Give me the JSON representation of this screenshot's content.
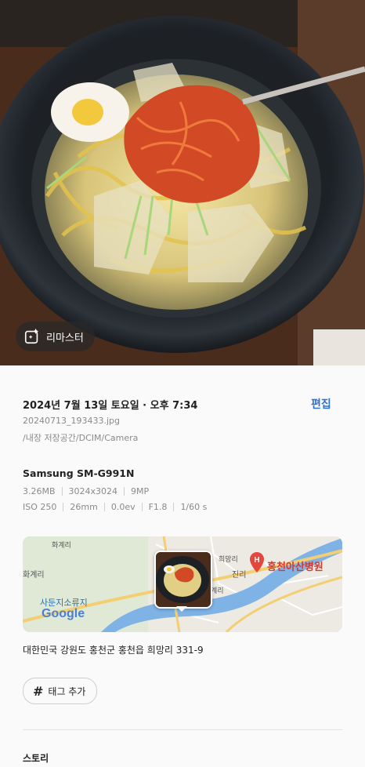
{
  "photo": {
    "alt": "냉면 사진",
    "remaster_label": "리마스터"
  },
  "details": {
    "datetime": "2024년 7월 13일 토요일 · 오후 7:34",
    "edit_label": "편집",
    "filename": "20240713_193433.jpg",
    "path": "/내장 저장공간/DCIM/Camera",
    "camera_model": "Samsung SM-G991N",
    "file_specs": [
      "3.26MB",
      "3024x3024",
      "9MP"
    ],
    "exposure_specs": [
      "ISO 250",
      "26mm",
      "0.0ev",
      "F1.8",
      "1/60 s"
    ]
  },
  "map": {
    "labels": {
      "nearby_hospital": "홍천아산병원",
      "fire_station": "사둔지소류지",
      "google": "Google",
      "village_1": "화계리",
      "village_2": "진리",
      "village_3": "희망리",
      "village_4": "화계리",
      "village_5": "계리"
    }
  },
  "address": "대한민국 강원도 홍천군 홍천읍 희망리 331-9",
  "tags": {
    "add_label": "태그 추가"
  },
  "story": {
    "title": "스토리"
  },
  "colors": {
    "accent": "#2f73c9",
    "map_water": "#7fb3e6",
    "map_road": "#f4cf72",
    "map_pin": "#e4473c"
  }
}
